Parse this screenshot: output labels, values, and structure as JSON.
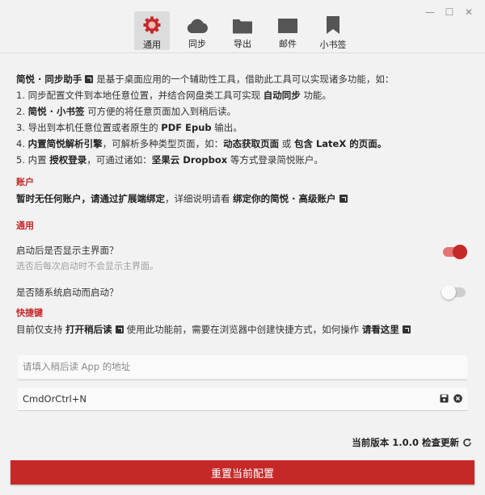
{
  "tabs": [
    {
      "label": "通用",
      "icon": "gear-icon",
      "active": true
    },
    {
      "label": "同步",
      "icon": "cloud-icon",
      "active": false
    },
    {
      "label": "导出",
      "icon": "folder-icon",
      "active": false
    },
    {
      "label": "邮件",
      "icon": "mail-icon",
      "active": false
    },
    {
      "label": "小书签",
      "icon": "bookmark-icon",
      "active": false
    }
  ],
  "intro": {
    "l1_bold": "简悦 · 同步助手",
    "l1_rest": "是基于桌面应用的一个辅助性工具，借助此工具可以实现诸多功能，如：",
    "l2_a": "1. 同步配置文件到本地任意位置，并结合网盘类工具可实现",
    "l2_b": "自动同步",
    "l2_c": "功能。",
    "l3_a": "2.",
    "l3_b": "简悦 · 小书签",
    "l3_c": "可方便的将任意页面加入到稍后读。",
    "l4_a": "3. 导出到本机任意位置或者原生的",
    "l4_b": "PDF Epub",
    "l4_c": "输出。",
    "l5_a": "4.",
    "l5_b": "内置简悦解析引擎",
    "l5_c": "，可解析多种类型页面，如：",
    "l5_d": "动态获取页面",
    "l5_e": "或",
    "l5_f": "包含 LateX 的页面。",
    "l6_a": "5. 内置",
    "l6_b": "授权登录",
    "l6_c": "，可通过诸如：",
    "l6_d": "坚果云 Dropbox",
    "l6_e": "等方式登录简悦账户。"
  },
  "account": {
    "title": "账户",
    "text_bold": "暂时无任何账户，请通过扩展端绑定",
    "text_mid": "，详细说明请看",
    "link": "绑定你的简悦 · 高级账户"
  },
  "general": {
    "title": "通用",
    "opt1_label": "启动后是否显示主界面？",
    "opt1_desc": "选否后每次启动时不会显示主界面。",
    "opt1_on": true,
    "opt2_label": "是否随系统启动而启动？",
    "opt2_on": false
  },
  "hotkey": {
    "title": "快捷键",
    "desc_a": "目前仅支持",
    "desc_b": "打开稍后读",
    "desc_c": "使用此功能前，需要在浏览器中创建快捷方式，如何操作",
    "desc_d": "请看这里",
    "url_placeholder": "请填入稍后读 App 的地址",
    "shortcut_value": "CmdOrCtrl+N"
  },
  "footer": {
    "version_label": "当前版本 1.0.0 检查更新",
    "reset_label": "重置当前配置"
  },
  "colors": {
    "accent": "#c62828",
    "background": "#f2f2f2"
  }
}
